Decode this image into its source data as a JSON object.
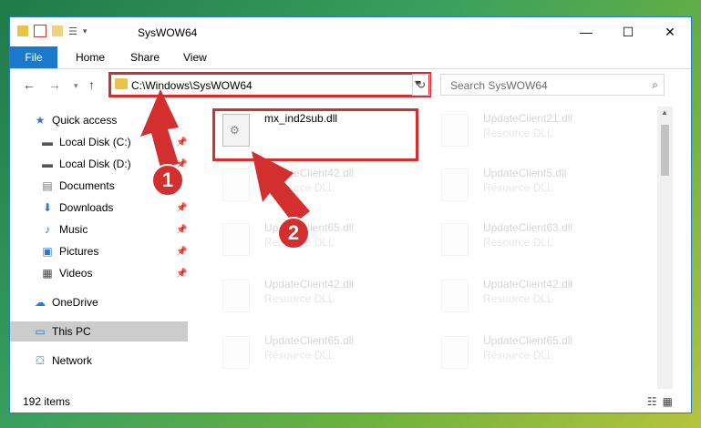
{
  "window": {
    "title": "SysWOW64"
  },
  "ribbon": {
    "file": "File",
    "home": "Home",
    "share": "Share",
    "view": "View"
  },
  "address": {
    "path": "C:\\Windows\\SysWOW64"
  },
  "search": {
    "placeholder": "Search SysWOW64"
  },
  "sidebar": {
    "items": [
      {
        "label": "Quick access"
      },
      {
        "label": "Local Disk (C:)"
      },
      {
        "label": "Local Disk (D:)"
      },
      {
        "label": "Documents"
      },
      {
        "label": "Downloads"
      },
      {
        "label": "Music"
      },
      {
        "label": "Pictures"
      },
      {
        "label": "Videos"
      },
      {
        "label": "OneDrive"
      },
      {
        "label": "This PC"
      },
      {
        "label": "Network"
      }
    ]
  },
  "files": [
    {
      "name": "mx_ind2sub.dll",
      "type": ""
    },
    {
      "name": "UpdateClient21.dll",
      "type": "Resource DLL"
    },
    {
      "name": "UpdateClient42.dll",
      "type": "Resource DLL"
    },
    {
      "name": "UpdateClient5.dll",
      "type": "Resource DLL"
    },
    {
      "name": "UpdateClient65.dll",
      "type": "Resource DLL"
    },
    {
      "name": "UpdateClient63.dll",
      "type": "Resource DLL"
    },
    {
      "name": "UpdateClient42.dll",
      "type": "Resource DLL"
    },
    {
      "name": "UpdateClient42.dll",
      "type": "Resource DLL"
    },
    {
      "name": "UpdateClient65.dll",
      "type": "Resource DLL"
    },
    {
      "name": "UpdateClient65.dll",
      "type": "Resource DLL"
    }
  ],
  "status": {
    "count": "192 items"
  },
  "annotations": {
    "step1": "1",
    "step2": "2"
  },
  "colors": {
    "accent": "#1979ca",
    "highlight": "#d32f2f"
  }
}
